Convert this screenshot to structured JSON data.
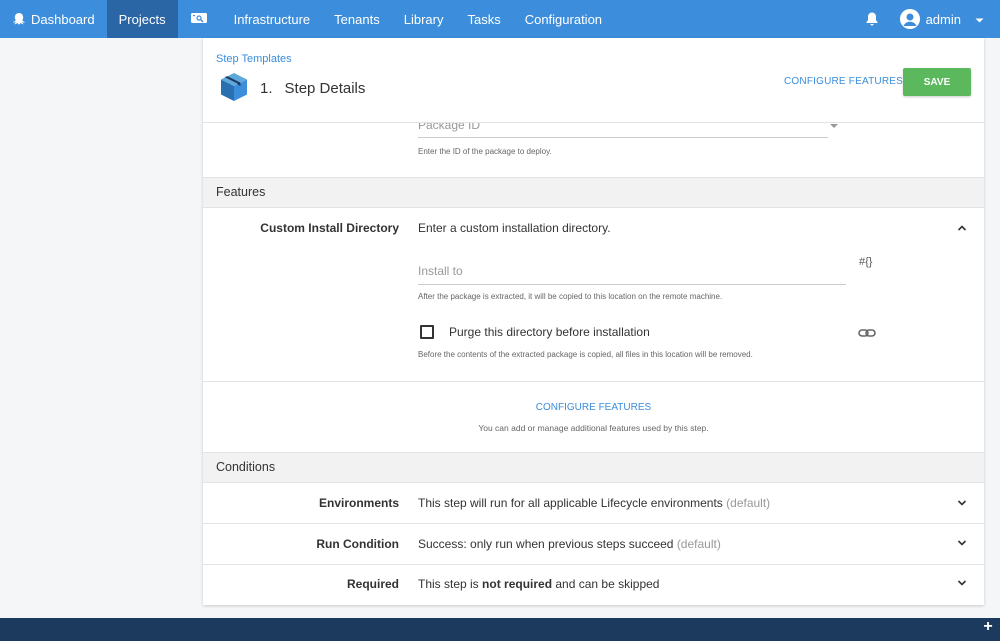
{
  "nav": {
    "items": [
      {
        "label": "Dashboard",
        "icon": "octopus-icon",
        "active": false
      },
      {
        "label": "Projects",
        "active": true
      },
      {
        "label": "",
        "icon": "search-machine-icon",
        "active": false
      },
      {
        "label": "Infrastructure",
        "active": false
      },
      {
        "label": "Tenants",
        "active": false
      },
      {
        "label": "Library",
        "active": false
      },
      {
        "label": "Tasks",
        "active": false
      },
      {
        "label": "Configuration",
        "active": false
      }
    ],
    "user": "admin"
  },
  "header": {
    "breadcrumb": "Step Templates",
    "step_number": "1.",
    "step_title": "Step Details",
    "configure_features": "CONFIGURE FEATURES",
    "save": "SAVE"
  },
  "package": {
    "placeholder": "Package ID",
    "help": "Enter the ID of the package to deploy."
  },
  "features": {
    "heading": "Features",
    "custom_install": {
      "label": "Custom Install Directory",
      "summary": "Enter a custom installation directory.",
      "install_to_placeholder": "Install to",
      "install_to_value": "",
      "variable_button": "#{}",
      "install_help": "After the package is extracted, it will be copied to this location on the remote machine.",
      "purge_label": "Purge this directory before installation",
      "purge_checked": false,
      "purge_help": "Before the contents of the extracted package is copied, all files in this location will be removed."
    },
    "configure_link": "CONFIGURE FEATURES",
    "configure_help": "You can add or manage additional features used by this step."
  },
  "conditions": {
    "heading": "Conditions",
    "rows": [
      {
        "label": "Environments",
        "text": "This step will run for all applicable Lifecycle environments",
        "suffix": "(default)"
      },
      {
        "label": "Run Condition",
        "text": "Success: only run when previous steps succeed",
        "suffix": "(default)"
      },
      {
        "label": "Required",
        "text_pre": "This step is ",
        "text_bold": "not required",
        "text_post": " and can be skipped"
      }
    ]
  },
  "colors": {
    "nav": "#3c8ddb",
    "nav_active": "#2a66a6",
    "link": "#3c8ddb",
    "save": "#5cb85c",
    "bottom_bar": "#1c3a5e"
  }
}
